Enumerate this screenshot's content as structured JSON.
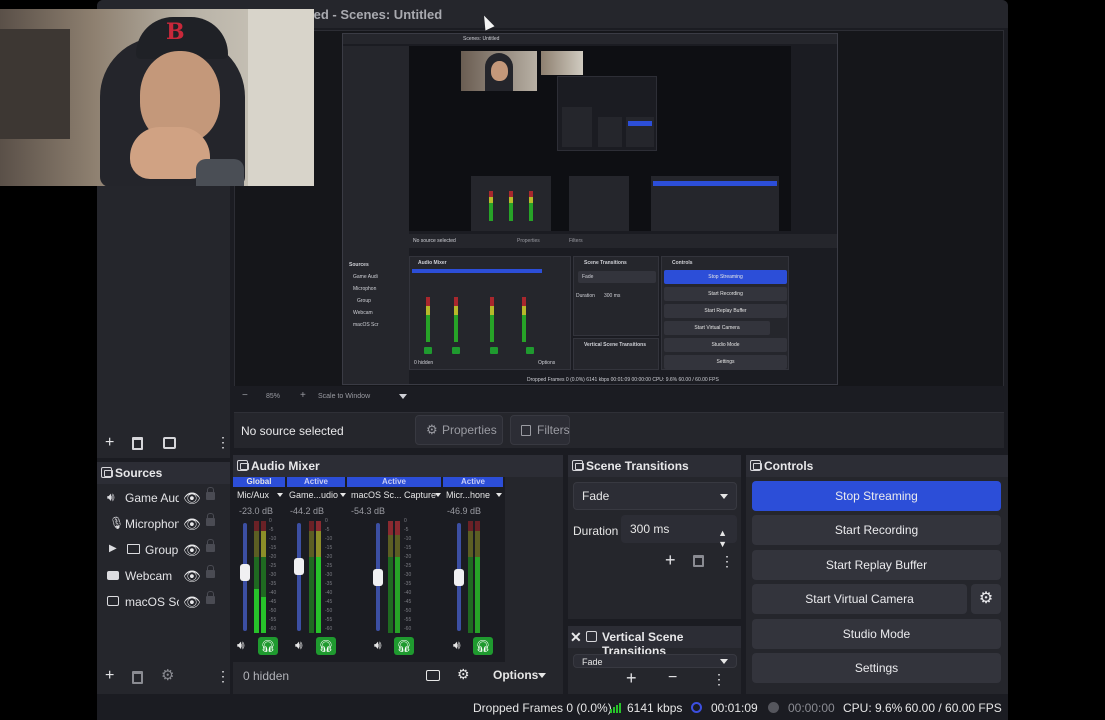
{
  "window": {
    "title": "ied - Scenes: Untitled"
  },
  "nested_preview": {
    "title": "Scenes: Untitled",
    "sources": [
      "Game Audi",
      "Microphon",
      "Group",
      "Webcam",
      "macOS Scr"
    ],
    "no_source": "No source selected",
    "properties": "Properties",
    "filters": "Filters",
    "audio_mixer": "Audio Mixer",
    "scene_transitions": "Scene Transitions",
    "controls": "Controls",
    "fade": "Fade",
    "duration": "Duration",
    "duration_value": "300 ms",
    "stop_streaming": "Stop Streaming",
    "start_recording": "Start Recording",
    "start_replay": "Start Replay Buffer",
    "start_virtual": "Start Virtual Camera",
    "studio_mode": "Studio Mode",
    "settings": "Settings",
    "vertical": "Vertical Scene Transitions",
    "hidden": "0 hidden",
    "options": "Options",
    "status": "Dropped Frames 0 (0.0%)   6141 kbps   00:01:09   00:00:00   CPU: 9.6%   60.00 / 60.00 FPS"
  },
  "zoom": {
    "minus": "−",
    "value": "85%",
    "plus": "+",
    "scale": "Scale to Window"
  },
  "source_toolbar": {
    "no_source": "No source selected",
    "properties": "Properties",
    "filters": "Filters"
  },
  "sources": {
    "title": "Sources",
    "items": [
      {
        "label": "Game Audi",
        "icon": "speaker-icon"
      },
      {
        "label": "Microphon",
        "icon": "microphone-icon"
      },
      {
        "label": "Group",
        "icon": "folder-icon"
      },
      {
        "label": "Webcam",
        "icon": "camera-icon"
      },
      {
        "label": "macOS Scr",
        "icon": "monitor-icon"
      }
    ]
  },
  "audio_mixer": {
    "title": "Audio Mixer",
    "channels": [
      {
        "tag": "Global",
        "name": "Mic/Aux",
        "db": "-23.0 dB",
        "fader_level": 0.55
      },
      {
        "tag": "Active",
        "name": "Game...udio",
        "db": "-44.2 dB",
        "fader_level": 0.6
      },
      {
        "tag": "Active",
        "name": "macOS Sc... Capture",
        "db": "-54.3 dB",
        "fader_level": 0.5
      },
      {
        "tag": "Active",
        "name": "Micr...hone",
        "db": "-46.9 dB",
        "fader_level": 0.5
      }
    ],
    "scale": [
      "0",
      "-5",
      "-10",
      "-15",
      "-20",
      "-25",
      "-30",
      "-35",
      "-40",
      "-45",
      "-50",
      "-55",
      "-60"
    ],
    "hidden": "0 hidden",
    "options": "Options"
  },
  "scene_transitions": {
    "title": "Scene Transitions",
    "transition": "Fade",
    "duration_label": "Duration",
    "duration_value": "300 ms"
  },
  "vertical_transitions": {
    "title": "Vertical Scene Transitions",
    "transition": "Fade"
  },
  "controls": {
    "title": "Controls",
    "stop_streaming": "Stop Streaming",
    "start_recording": "Start Recording",
    "start_replay_buffer": "Start Replay Buffer",
    "start_virtual_camera": "Start Virtual Camera",
    "studio_mode": "Studio Mode",
    "settings": "Settings"
  },
  "status": {
    "dropped_frames": "Dropped Frames 0 (0.0%)",
    "bitrate": "6141 kbps",
    "stream_time": "00:01:09",
    "record_time": "00:00:00",
    "cpu": "CPU: 9.6%",
    "fps": "60.00 / 60.00 FPS"
  },
  "colors": {
    "accent": "#2c4ed8",
    "panel": "#25262c",
    "background": "#1b1c22",
    "meter_green": "#27a327",
    "meter_yellow": "#b7b92a",
    "meter_red": "#a8272d"
  }
}
